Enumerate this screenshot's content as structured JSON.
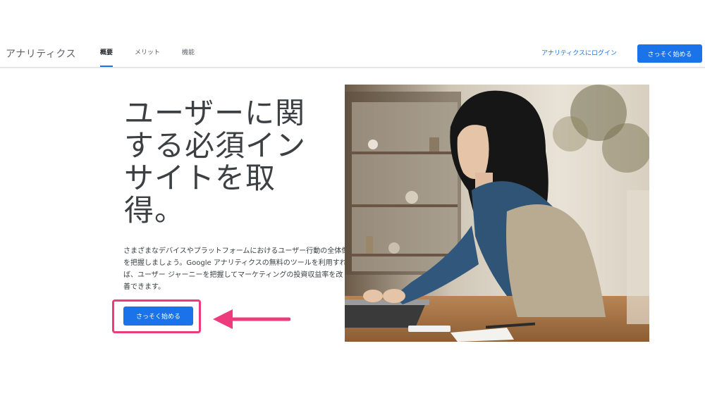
{
  "header": {
    "brand": "アナリティクス",
    "tabs": [
      {
        "label": "概要",
        "active": true
      },
      {
        "label": "メリット",
        "active": false
      },
      {
        "label": "機能",
        "active": false
      }
    ],
    "login_link": "アナリティクスにログイン",
    "cta_label": "さっそく始める"
  },
  "hero": {
    "headline": "ユーザーに関する必須インサイトを取得。",
    "description": "さまざまなデバイスやプラットフォームにおけるユーザー行動の全体像を把握しましょう。Google アナリティクスの無料のツールを利用すれば、ユーザー ジャーニーを把握してマーケティングの投資収益率を改善できます。",
    "cta_label": "さっそく始める"
  },
  "colors": {
    "accent": "#1a73e8",
    "annotation": "#ee3b7b"
  },
  "icons": {
    "annotation_arrow": "arrow-left-icon"
  }
}
